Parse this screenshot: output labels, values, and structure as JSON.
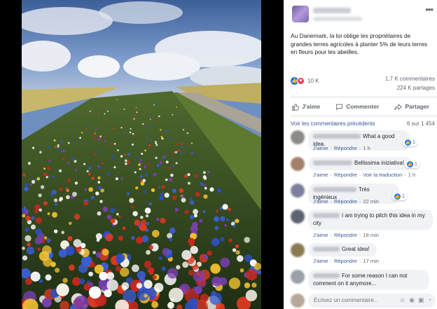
{
  "post": {
    "text": "Au Danemark, la loi oblige les propriétaires de grandes terres agricoles à planter 5% de leurs terres en fleurs pour les abeilles.",
    "reactions_count": "10 K",
    "comments_count": "1,7 K commentaires",
    "shares_count": "224 K partages",
    "more_label": "•••"
  },
  "actions": {
    "like": "J'aime",
    "comment": "Commenter",
    "share": "Partager"
  },
  "comments_header": {
    "previous": "Voir les commentaires précédents",
    "count": "6 sur 1 454"
  },
  "comments": [
    {
      "text": "What a good idea.",
      "like": "J'aime",
      "reply": "Répondre",
      "time": "1 h",
      "reactions": "1"
    },
    {
      "text": "Bellissima iniziativa!",
      "like": "J'aime",
      "reply": "Répondre",
      "translate": "Voir la traduction",
      "time": "1 h",
      "reactions": "1"
    },
    {
      "text": "Très ingénieux",
      "like": "J'aime",
      "reply": "Répondre",
      "time": "22 min",
      "reactions": "1"
    },
    {
      "text": "I am trying to pitch this idea in my city",
      "like": "J'aime",
      "reply": "Répondre",
      "time": "18 min"
    },
    {
      "text": "Great idea!",
      "like": "J'aime",
      "reply": "Répondre",
      "time": "17 min"
    },
    {
      "text": "For some reason I can not comment on it anymore..."
    }
  ],
  "composer": {
    "placeholder": "Écrivez un commentaire..."
  },
  "colors": {
    "link": "#385898",
    "like_blue": "#1877f2",
    "love_red": "#f33e58",
    "bubble": "#f0f2f5"
  }
}
